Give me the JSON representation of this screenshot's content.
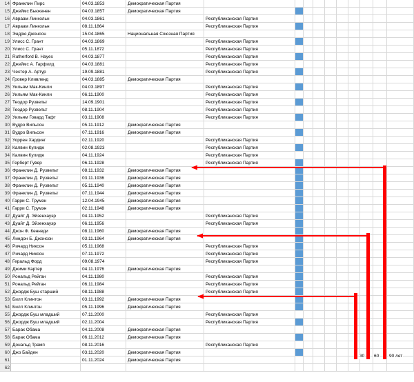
{
  "spreadsheet": {
    "rows": [
      {
        "n": "14",
        "name": "Франклин Пирс",
        "date": "04.03.1853",
        "dem": "Демократическая Партия",
        "rep": "",
        "blue": false
      },
      {
        "n": "15",
        "name": "Джеймс Бьюкенен",
        "date": "04.03.1857",
        "dem": "Демократическая Партия",
        "rep": "",
        "blue": true
      },
      {
        "n": "16",
        "name": "Авраам Линкольн",
        "date": "04.03.1861",
        "dem": "",
        "rep": "Республиканская Партия",
        "blue": false
      },
      {
        "n": "17",
        "name": "Авраам Линкольн",
        "date": "08.11.1864",
        "dem": "",
        "rep": "Республиканская Партия",
        "blue": true
      },
      {
        "n": "18",
        "name": "Эндрю Джонсон",
        "date": "15.04.1865",
        "dem": "Национальная Союзная Партия",
        "rep": "",
        "blue": false
      },
      {
        "n": "19",
        "name": "Улисс С. Грант",
        "date": "04.03.1869",
        "dem": "",
        "rep": "Республиканская Партия",
        "blue": true
      },
      {
        "n": "20",
        "name": "Улисс С. Грант",
        "date": "05.11.1872",
        "dem": "",
        "rep": "Республиканская Партия",
        "blue": false
      },
      {
        "n": "21",
        "name": "Rutherford B. Hayes",
        "date": "04.03.1877",
        "dem": "",
        "rep": "Республиканская Партия",
        "blue": true
      },
      {
        "n": "22",
        "name": "Джеймс А. Гарфилд",
        "date": "04.03.1881",
        "dem": "",
        "rep": "Республиканская Партия",
        "blue": false
      },
      {
        "n": "23",
        "name": "Честер А. Артур",
        "date": "19.09.1881",
        "dem": "",
        "rep": "Республиканская Партия",
        "blue": true
      },
      {
        "n": "24",
        "name": "Гровер Кливленд",
        "date": "04.03.1885",
        "dem": "Демократическая Партия",
        "rep": "",
        "blue": false
      },
      {
        "n": "25",
        "name": "Уильям Мак-Кинли",
        "date": "04.03.1897",
        "dem": "",
        "rep": "Республиканская Партия",
        "blue": true
      },
      {
        "n": "26",
        "name": "Уильям Мак-Кинли",
        "date": "06.11.1900",
        "dem": "",
        "rep": "Республиканская Партия",
        "blue": false
      },
      {
        "n": "27",
        "name": "Теодор Рузвельт",
        "date": "14.09.1901",
        "dem": "",
        "rep": "Республиканская Партия",
        "blue": true
      },
      {
        "n": "28",
        "name": "Теодор Рузвельт",
        "date": "08.11.1904",
        "dem": "",
        "rep": "Республиканская Партия",
        "blue": false
      },
      {
        "n": "29",
        "name": "Уильям Говард Тафт",
        "date": "03.11.1908",
        "dem": "",
        "rep": "Республиканская Партия",
        "blue": true
      },
      {
        "n": "30",
        "name": "Вудро Вильсон",
        "date": "05.11.1912",
        "dem": "Демократическая Партия",
        "rep": "",
        "blue": false
      },
      {
        "n": "31",
        "name": "Вудро Вильсон",
        "date": "07.11.1916",
        "dem": "Демократическая Партия",
        "rep": "",
        "blue": true
      },
      {
        "n": "32",
        "name": "Уоррен Хардинг",
        "date": "02.11.1920",
        "dem": "",
        "rep": "Республиканская Партия",
        "blue": false
      },
      {
        "n": "33",
        "name": "Калвин Кулидж",
        "date": "02.08.1923",
        "dem": "",
        "rep": "Республиканская Партия",
        "blue": true
      },
      {
        "n": "34",
        "name": "Калвин Кулидж",
        "date": "04.11.1924",
        "dem": "",
        "rep": "Республиканская Партия",
        "blue": false
      },
      {
        "n": "35",
        "name": "Герберт Гувер",
        "date": "06.11.1928",
        "dem": "",
        "rep": "Республиканская Партия",
        "blue": true
      },
      {
        "n": "36",
        "name": "Франклин Д. Рузвельт",
        "date": "08.11.1932",
        "dem": "Демократическая Партия",
        "rep": "",
        "blue": true
      },
      {
        "n": "37",
        "name": "Франклин Д. Рузвельт",
        "date": "03.11.1936",
        "dem": "Демократическая Партия",
        "rep": "",
        "blue": true
      },
      {
        "n": "38",
        "name": "Франклин Д. Рузвельт",
        "date": "05.11.1940",
        "dem": "Демократическая Партия",
        "rep": "",
        "blue": true
      },
      {
        "n": "39",
        "name": "Франклин Д. Рузвельт",
        "date": "07.11.1944",
        "dem": "Демократическая Партия",
        "rep": "",
        "blue": true
      },
      {
        "n": "40",
        "name": "Гарри С. Трумэн",
        "date": "12.04.1945",
        "dem": "Демократическая Партия",
        "rep": "",
        "blue": true
      },
      {
        "n": "41",
        "name": "Гарри С. Трумэн",
        "date": "02.11.1948",
        "dem": "Демократическая Партия",
        "rep": "",
        "blue": true
      },
      {
        "n": "42",
        "name": "Дуайт Д. Эйзенхауэр",
        "date": "04.11.1952",
        "dem": "",
        "rep": "Республиканская Партия",
        "blue": true
      },
      {
        "n": "43",
        "name": "Дуайт Д. Эйзенхауэр",
        "date": "06.11.1956",
        "dem": "",
        "rep": "Республиканская Партия",
        "blue": true
      },
      {
        "n": "44",
        "name": "Джон Ф. Кеннеди",
        "date": "08.11.1960",
        "dem": "Демократическая Партия",
        "rep": "",
        "blue": true
      },
      {
        "n": "45",
        "name": "Линдон Б. Джонсон",
        "date": "03.11.1964",
        "dem": "Демократическая Партия",
        "rep": "",
        "blue": true
      },
      {
        "n": "46",
        "name": "Ричард Никсон",
        "date": "05.11.1968",
        "dem": "",
        "rep": "Республиканская Партия",
        "blue": true
      },
      {
        "n": "47",
        "name": "Ричард Никсон",
        "date": "07.11.1972",
        "dem": "",
        "rep": "Республиканская Партия",
        "blue": true
      },
      {
        "n": "48",
        "name": "Геральд Форд",
        "date": "09.08.1974",
        "dem": "",
        "rep": "Республиканская Партия",
        "blue": true
      },
      {
        "n": "49",
        "name": "Джими Картер",
        "date": "04.11.1976",
        "dem": "Демократическая Партия",
        "rep": "",
        "blue": true
      },
      {
        "n": "50",
        "name": "Рональд Рейган",
        "date": "04.11.1980",
        "dem": "",
        "rep": "Республиканская Партия",
        "blue": true
      },
      {
        "n": "51",
        "name": "Рональд Рейган",
        "date": "06.11.1984",
        "dem": "",
        "rep": "Республиканская Партия",
        "blue": true
      },
      {
        "n": "52",
        "name": "Джордж Буш старший",
        "date": "08.11.1988",
        "dem": "",
        "rep": "Республиканская Партия",
        "blue": true
      },
      {
        "n": "53",
        "name": "Билл Клинтон",
        "date": "03.11.1992",
        "dem": "Демократическая Партия",
        "rep": "",
        "blue": true
      },
      {
        "n": "54",
        "name": "Билл Клинтон",
        "date": "05.11.1996",
        "dem": "Демократическая Партия",
        "rep": "",
        "blue": true
      },
      {
        "n": "55",
        "name": "Джордж Буш младший",
        "date": "07.11.2000",
        "dem": "",
        "rep": "Республиканская Партия",
        "blue": false
      },
      {
        "n": "56",
        "name": "Джордж Буш младший",
        "date": "02.11.2004",
        "dem": "",
        "rep": "Республиканская Партия",
        "blue": true
      },
      {
        "n": "57",
        "name": "Барак Обама",
        "date": "04.11.2008",
        "dem": "Демократическая Партия",
        "rep": "",
        "blue": false
      },
      {
        "n": "58",
        "name": "Барак Обама",
        "date": "06.11.2012",
        "dem": "Демократическая Партия",
        "rep": "",
        "blue": true
      },
      {
        "n": "59",
        "name": "Дональд Трамп",
        "date": "08.11.2016",
        "dem": "",
        "rep": "Республиканская Партия",
        "blue": false
      },
      {
        "n": "60",
        "name": "Джо Байден",
        "date": "03.11.2020",
        "dem": "Демократическая Партия",
        "rep": "",
        "blue": true
      },
      {
        "n": "61",
        "name": "",
        "date": "01.11.2024",
        "dem": "Демократическая Партия",
        "rep": "",
        "blue": false
      },
      {
        "n": "62",
        "name": "",
        "date": "",
        "dem": "",
        "rep": "",
        "blue": false
      }
    ]
  },
  "annotations": {
    "label_30": "30",
    "label_60": "60",
    "label_90": "90 лет",
    "arrow_color": "#ff0000",
    "bar_color": "#5b9bd5"
  }
}
